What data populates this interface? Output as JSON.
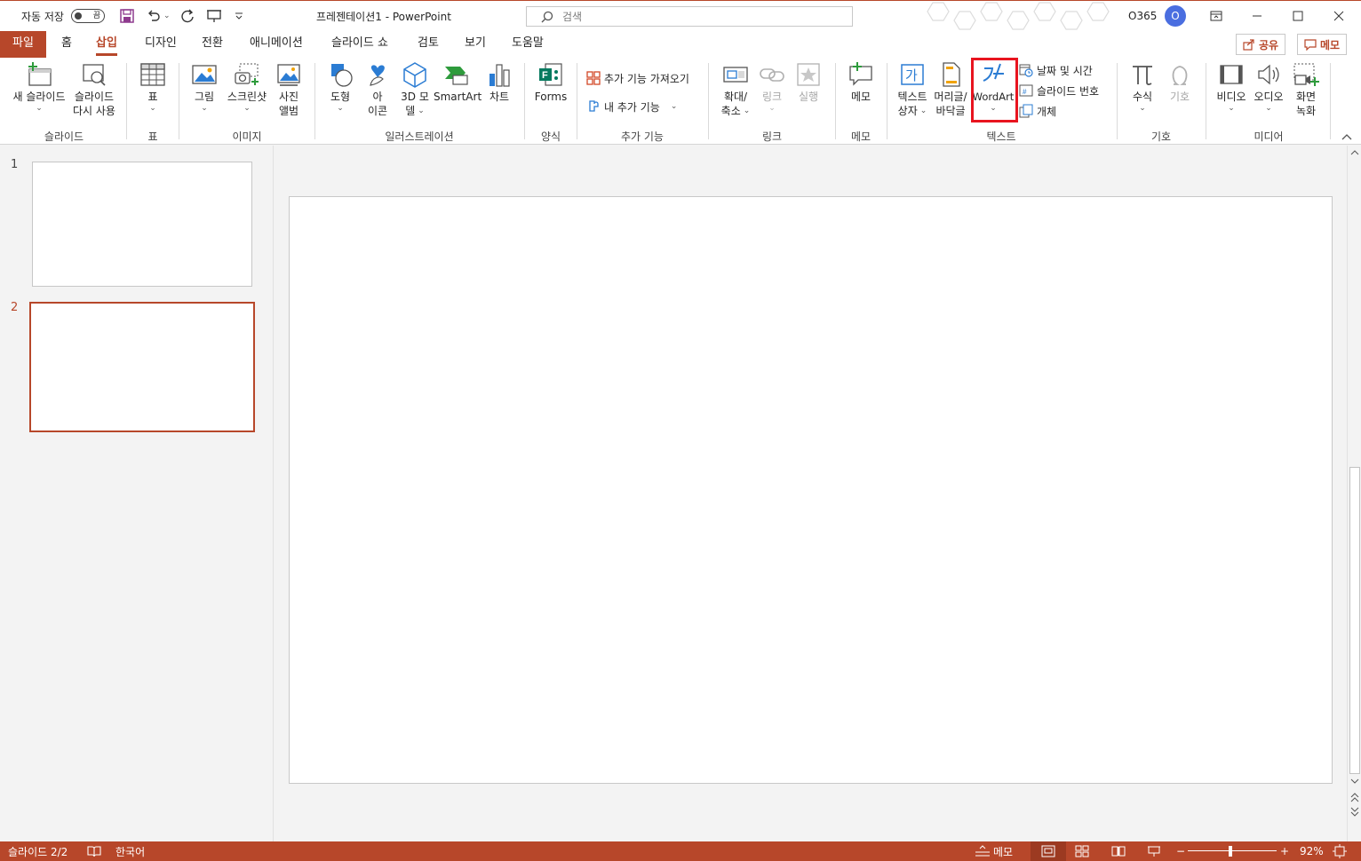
{
  "titlebar": {
    "autosave_label": "자동 저장",
    "autosave_state": "끔",
    "document_title": "프레젠테이션1  -  PowerPoint",
    "search_placeholder": "검색",
    "account_label": "O365",
    "avatar_initial": "O"
  },
  "tabs": [
    "파일",
    "홈",
    "삽입",
    "디자인",
    "전환",
    "애니메이션",
    "슬라이드 쇼",
    "검토",
    "보기",
    "도움말"
  ],
  "active_tab": "삽입",
  "header_buttons": {
    "share": "공유",
    "comments": "메모"
  },
  "ribbon": {
    "slides": {
      "new_slide": [
        "새 슬라이드"
      ],
      "reuse": [
        "슬라이드",
        "다시 사용"
      ],
      "label": "슬라이드"
    },
    "tables": {
      "table": "표",
      "label": "표"
    },
    "images": {
      "picture": "그림",
      "screenshot": "스크린샷",
      "album": [
        "사진",
        "앨범"
      ],
      "label": "이미지"
    },
    "illustrations": {
      "shapes": "도형",
      "icons": [
        "아",
        "이콘"
      ],
      "models3d": [
        "3D 모",
        "델"
      ],
      "smartart": "SmartArt",
      "chart": "차트",
      "label": "일러스트레이션"
    },
    "forms": {
      "forms": "Forms",
      "label": "양식"
    },
    "addins": {
      "get_addins": "추가 기능 가져오기",
      "my_addins": "내 추가 기능",
      "label": "추가 기능"
    },
    "links": {
      "zoom": [
        "확대/",
        "축소"
      ],
      "link": "링크",
      "action": "실행",
      "label": "링크"
    },
    "comments": {
      "comment": "메모",
      "label": "메모"
    },
    "text": {
      "textbox": [
        "텍스트",
        "상자"
      ],
      "header_footer": [
        "머리글/",
        "바닥글"
      ],
      "wordart": "WordArt",
      "date_time": "날짜 및 시간",
      "slide_number": "슬라이드 번호",
      "object": "개체",
      "label": "텍스트"
    },
    "symbols": {
      "equation": "수식",
      "symbol": "기호",
      "label": "기호"
    },
    "media": {
      "video": "비디오",
      "audio": "오디오",
      "screen_recording": [
        "화면",
        "녹화"
      ],
      "label": "미디어"
    }
  },
  "slides": [
    {
      "number": "1"
    },
    {
      "number": "2"
    }
  ],
  "selected_slide": "2",
  "statusbar": {
    "slide_info": "슬라이드 2/2",
    "language": "한국어",
    "notes": "메모",
    "zoom": "92%",
    "zoom_minus": "−",
    "zoom_plus": "+"
  },
  "colors": {
    "accent": "#b7472a",
    "highlight": "#e8141f",
    "icon_blue": "#2b7cd3"
  }
}
